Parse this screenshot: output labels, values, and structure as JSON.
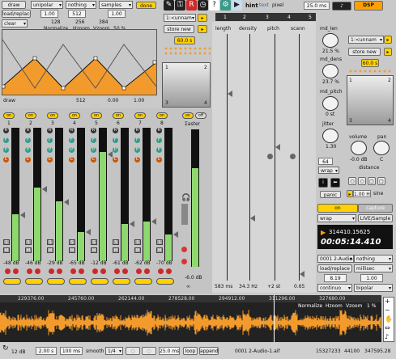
{
  "toolbar": {
    "draw": "draw",
    "unipolar": "unipolar",
    "nothing": "nothing",
    "samples": "samples",
    "done": "done",
    "load_replace": "load/replace",
    "val_1": "1.00",
    "val_512": "512",
    "val_1b": "1.00",
    "clear": "clear",
    "hdr_128": "128",
    "hdr_256": "256",
    "hdr_384": "384",
    "normalize": "Normalize",
    "hzoom": "Hzoom",
    "vzoom": "Vzoom",
    "vzoom_pct": "50 %",
    "wave_draw": "draw",
    "wave_512": "512",
    "wave_000": "0.00",
    "wave_100": "1.00",
    "hint": "hint",
    "text": "text",
    "pixel": "pixel",
    "time_ms": "25.0 ms",
    "dsp": "DSP",
    "tab1": "1",
    "tab2": "2",
    "tab3": "3",
    "tab4": "4",
    "tab5": "5"
  },
  "preset": {
    "name": "1:<unnam",
    "store": "store new",
    "ms": "60.0 s",
    "c1": "1",
    "c2": "2",
    "c3": "3",
    "c4": "4"
  },
  "params": {
    "length": "length",
    "density": "density",
    "pitch": "pitch",
    "scan": "scann",
    "length_val": "583 ms",
    "density_val": "34.3 Hz",
    "pitch_val": "+2 st",
    "scan_val": "0.65"
  },
  "right_panel": {
    "md_len": "md_len",
    "md_len_val": "21.5 %",
    "md_dens": "md_dens",
    "md_dens_val": "23.7 %",
    "md_pitch": "md_pitch",
    "md_pitch_val": "0 st",
    "jitter": "jitter",
    "jitter_val": "1.30",
    "volume": "volume",
    "volume_val": "-0.0 dB",
    "pan": "pan",
    "pan_val": "C",
    "distance": "distance",
    "preset_name": "1:<unnam",
    "store": "store new",
    "time": "60.0 s",
    "c1": "1",
    "c2": "2",
    "c3": "3",
    "c4": "4",
    "v64": "64",
    "wrap": "wrap",
    "panic": "panic",
    "hz": "1.00 Hz",
    "sine": "sine",
    "on": "on",
    "capture": "capture",
    "wrap2": "wrap",
    "live_sample": "LIVE/Sample",
    "counter": "314410.15625",
    "clock": "00:05:14.410",
    "audio_file": "0001 2-Audio-",
    "nothing": "nothing",
    "load_replace": "load/replace",
    "millisec": "millisec",
    "v819": "8.19",
    "v100": "1.00",
    "continuo": "continuo",
    "bipolar": "bipolar"
  },
  "mixer": {
    "channels": [
      {
        "id": "1",
        "db": "-48 dB",
        "level": 0.35
      },
      {
        "id": "2",
        "db": "-46 dB",
        "level": 0.55
      },
      {
        "id": "3",
        "db": "-29 dB",
        "level": 0.45
      },
      {
        "id": "4",
        "db": "-65 dB",
        "level": 0.22
      },
      {
        "id": "5",
        "db": "-12 dB",
        "level": 0.82
      },
      {
        "id": "6",
        "db": "-61 dB",
        "level": 0.28
      },
      {
        "id": "7",
        "db": "-62 dB",
        "level": 0.3
      },
      {
        "id": "8",
        "db": "-70 dB",
        "level": 0.2
      }
    ],
    "letters": [
      "R",
      "F",
      "P",
      "C"
    ],
    "master_label": "Σaster",
    "master_db": "-6.0 dB",
    "master_level": 0.72,
    "on": "on",
    "off": "off",
    "s": "S",
    "m": "M"
  },
  "waveform": {
    "markers": [
      "229376.00",
      "245760.00",
      "262144.00",
      "278528.00",
      "294912.00",
      "311296.00",
      "327680.00"
    ],
    "normalize": "Normalize",
    "hzoom": "Hzoom",
    "vzoom": "Vzoom",
    "vzoom_pct": "1 %"
  },
  "statusbar": {
    "db": "12 dB",
    "s": "2.00 s",
    "ms100": "100 ms",
    "smooth": "smooth",
    "v4": "1/4",
    "ms25": "25.0 ms",
    "loop": "loop",
    "append": "append",
    "file": "0001 2-Audio-1.aif",
    "a": "15327233",
    "b": "44100",
    "c": "347595.28"
  },
  "colors": {
    "yellow": "#ffd100",
    "orange": "#f29b2c",
    "green": "#8fd870",
    "red": "#cc2a2a",
    "teal": "#3a9a8a"
  }
}
